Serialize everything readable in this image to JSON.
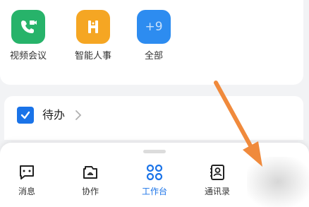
{
  "apps": [
    {
      "label": "视频会议",
      "icon": "video-call-phone-icon",
      "color": "#27b36a"
    },
    {
      "label": "智能人事",
      "icon": "hr-h-icon",
      "color": "#f5a623"
    },
    {
      "label": "全部",
      "icon": "all-apps-plus9-icon",
      "color": "#2d8cf0",
      "badge": "+9"
    }
  ],
  "todo": {
    "label": "待办",
    "checked": true
  },
  "nav": [
    {
      "label": "消息",
      "icon": "message-bubble-icon"
    },
    {
      "label": "协作",
      "icon": "collaboration-icon"
    },
    {
      "label": "工作台",
      "icon": "workbench-grid-icon",
      "active": true
    },
    {
      "label": "通讯录",
      "icon": "contacts-icon"
    }
  ],
  "colors": {
    "accent": "#1a73e8",
    "annotation_arrow": "#f08a3c"
  }
}
